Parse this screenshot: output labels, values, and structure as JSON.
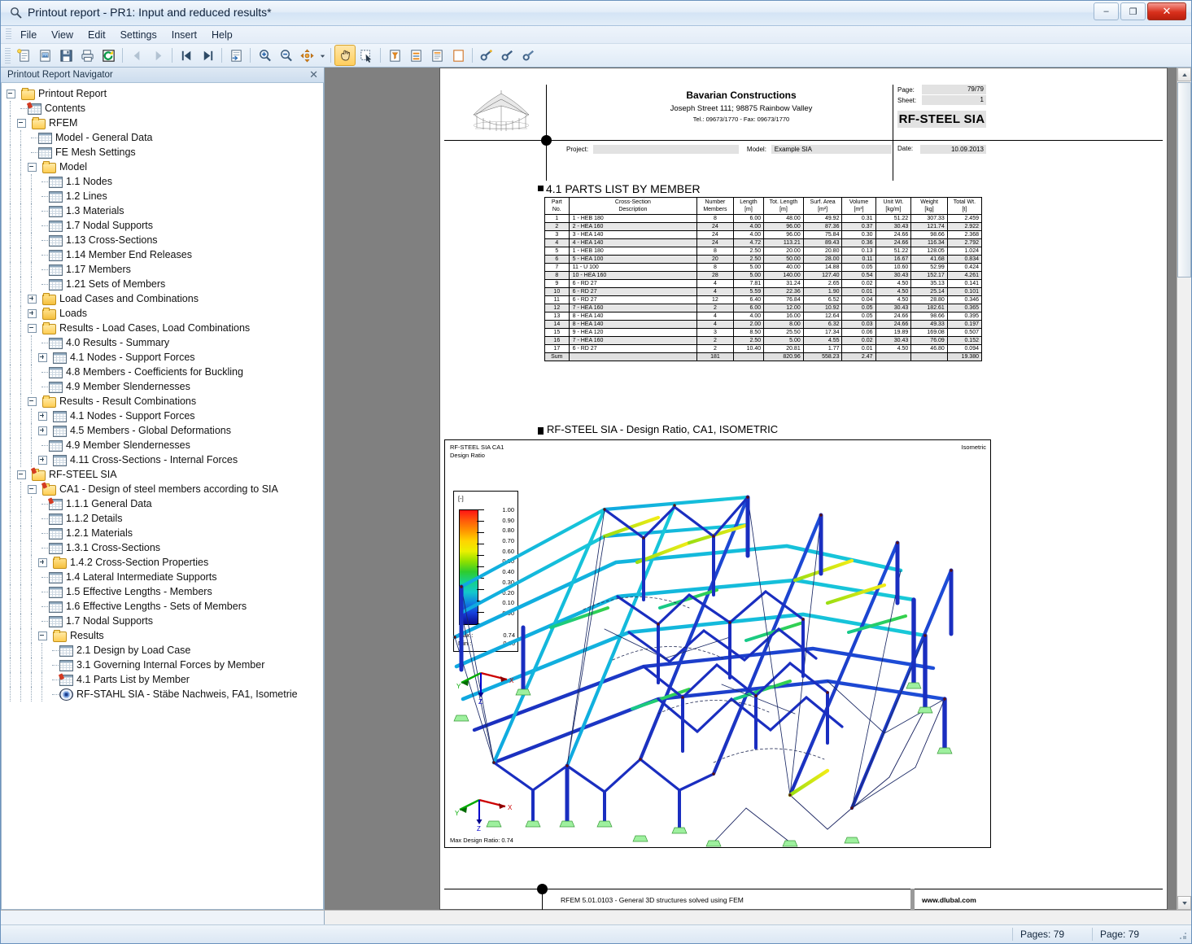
{
  "window": {
    "title": "Printout report - PR1: Input and reduced results*",
    "icon": "magnifier-document-icon",
    "minimize": "–",
    "maximize": "❐",
    "close": "✕"
  },
  "menubar": {
    "items": [
      {
        "label": "File",
        "name": "menu-file"
      },
      {
        "label": "View",
        "name": "menu-view"
      },
      {
        "label": "Edit",
        "name": "menu-edit"
      },
      {
        "label": "Settings",
        "name": "menu-settings"
      },
      {
        "label": "Insert",
        "name": "menu-insert"
      },
      {
        "label": "Help",
        "name": "menu-help"
      }
    ]
  },
  "toolbar": {
    "buttons": [
      {
        "name": "new-report-icon",
        "glyph": "📄",
        "state": "normal"
      },
      {
        "name": "open-report-icon",
        "glyph": "📂",
        "state": "normal"
      },
      {
        "name": "save-report-icon",
        "glyph": "💾",
        "state": "normal"
      },
      {
        "name": "print-icon",
        "glyph": "🖨",
        "state": "normal"
      },
      {
        "name": "refresh-icon",
        "glyph": "↻",
        "state": "normal"
      },
      {
        "name": "sep",
        "glyph": "",
        "state": "sep"
      },
      {
        "name": "previous-page-icon",
        "glyph": "◀",
        "state": "disabled"
      },
      {
        "name": "next-page-icon",
        "glyph": "▶",
        "state": "disabled"
      },
      {
        "name": "sep",
        "glyph": "",
        "state": "sep"
      },
      {
        "name": "first-page-icon",
        "glyph": "⏮",
        "state": "normal"
      },
      {
        "name": "last-page-icon",
        "glyph": "⏭",
        "state": "normal"
      },
      {
        "name": "sep",
        "glyph": "",
        "state": "sep"
      },
      {
        "name": "export-pdf-icon",
        "glyph": "📑",
        "state": "normal"
      },
      {
        "name": "sep",
        "glyph": "",
        "state": "sep"
      },
      {
        "name": "zoom-in-icon",
        "glyph": "🔍",
        "state": "normal"
      },
      {
        "name": "zoom-out-icon",
        "glyph": "🔎",
        "state": "normal"
      },
      {
        "name": "pan-move-icon",
        "glyph": "✥",
        "state": "normal"
      },
      {
        "name": "dropdown-arrow-icon",
        "glyph": "▾",
        "state": "small"
      },
      {
        "name": "sep",
        "glyph": "",
        "state": "sep"
      },
      {
        "name": "hand-tool-icon",
        "glyph": "✋",
        "state": "active"
      },
      {
        "name": "select-tool-icon",
        "glyph": "➤",
        "state": "normal"
      },
      {
        "name": "sep",
        "glyph": "",
        "state": "sep"
      },
      {
        "name": "filter-report-icon",
        "glyph": "▽",
        "state": "normal"
      },
      {
        "name": "report-settings-icon",
        "glyph": "☰",
        "state": "normal"
      },
      {
        "name": "page-setup-icon",
        "glyph": "≡",
        "state": "normal"
      },
      {
        "name": "blank-page-icon",
        "glyph": "▭",
        "state": "normal"
      },
      {
        "name": "sep",
        "glyph": "",
        "state": "sep"
      },
      {
        "name": "insert-link-icon",
        "glyph": "🔗",
        "state": "normal"
      },
      {
        "name": "edit-link-icon",
        "glyph": "🔗",
        "state": "normal"
      },
      {
        "name": "remove-link-icon",
        "glyph": "🔗",
        "state": "normal"
      }
    ]
  },
  "navigator": {
    "title": "Printout Report Navigator",
    "close_glyph": "✕",
    "tree": [
      {
        "label": "Printout Report",
        "depth": 0,
        "icon": "folder-open",
        "expander": "minus"
      },
      {
        "label": "Contents",
        "depth": 1,
        "icon": "sheet-pin",
        "expander": "none"
      },
      {
        "label": "RFEM",
        "depth": 1,
        "icon": "folder-open",
        "expander": "minus"
      },
      {
        "label": "Model - General Data",
        "depth": 2,
        "icon": "sheet",
        "expander": "none"
      },
      {
        "label": "FE Mesh Settings",
        "depth": 2,
        "icon": "sheet",
        "expander": "none"
      },
      {
        "label": "Model",
        "depth": 2,
        "icon": "folder-open",
        "expander": "minus"
      },
      {
        "label": "1.1 Nodes",
        "depth": 3,
        "icon": "sheet",
        "expander": "none"
      },
      {
        "label": "1.2 Lines",
        "depth": 3,
        "icon": "sheet",
        "expander": "none"
      },
      {
        "label": "1.3 Materials",
        "depth": 3,
        "icon": "sheet",
        "expander": "none"
      },
      {
        "label": "1.7 Nodal Supports",
        "depth": 3,
        "icon": "sheet",
        "expander": "none"
      },
      {
        "label": "1.13 Cross-Sections",
        "depth": 3,
        "icon": "sheet",
        "expander": "none"
      },
      {
        "label": "1.14 Member End Releases",
        "depth": 3,
        "icon": "sheet",
        "expander": "none"
      },
      {
        "label": "1.17 Members",
        "depth": 3,
        "icon": "sheet",
        "expander": "none"
      },
      {
        "label": "1.21 Sets of Members",
        "depth": 3,
        "icon": "sheet",
        "expander": "none"
      },
      {
        "label": "Load Cases and Combinations",
        "depth": 2,
        "icon": "folder",
        "expander": "plus"
      },
      {
        "label": "Loads",
        "depth": 2,
        "icon": "folder",
        "expander": "plus"
      },
      {
        "label": "Results - Load Cases, Load Combinations",
        "depth": 2,
        "icon": "folder-open",
        "expander": "minus"
      },
      {
        "label": "4.0 Results - Summary",
        "depth": 3,
        "icon": "sheet",
        "expander": "none"
      },
      {
        "label": "4.1 Nodes - Support Forces",
        "depth": 3,
        "icon": "sheet",
        "expander": "plus"
      },
      {
        "label": "4.8 Members - Coefficients for Buckling",
        "depth": 3,
        "icon": "sheet",
        "expander": "none"
      },
      {
        "label": "4.9 Member Slendernesses",
        "depth": 3,
        "icon": "sheet",
        "expander": "none"
      },
      {
        "label": "Results - Result Combinations",
        "depth": 2,
        "icon": "folder-open",
        "expander": "minus"
      },
      {
        "label": "4.1 Nodes - Support Forces",
        "depth": 3,
        "icon": "sheet",
        "expander": "plus"
      },
      {
        "label": "4.5 Members - Global Deformations",
        "depth": 3,
        "icon": "sheet",
        "expander": "plus"
      },
      {
        "label": "4.9 Member Slendernesses",
        "depth": 3,
        "icon": "sheet",
        "expander": "none"
      },
      {
        "label": "4.11 Cross-Sections - Internal Forces",
        "depth": 3,
        "icon": "sheet",
        "expander": "plus"
      },
      {
        "label": "RF-STEEL SIA",
        "depth": 1,
        "icon": "folder-pin",
        "expander": "minus"
      },
      {
        "label": "CA1 - Design of steel members according to SIA",
        "depth": 2,
        "icon": "folder-pin",
        "expander": "minus"
      },
      {
        "label": "1.1.1 General Data",
        "depth": 3,
        "icon": "sheet-pin",
        "expander": "none"
      },
      {
        "label": "1.1.2 Details",
        "depth": 3,
        "icon": "sheet",
        "expander": "none"
      },
      {
        "label": "1.2.1 Materials",
        "depth": 3,
        "icon": "sheet",
        "expander": "none"
      },
      {
        "label": "1.3.1 Cross-Sections",
        "depth": 3,
        "icon": "sheet",
        "expander": "none"
      },
      {
        "label": "1.4.2 Cross-Section Properties",
        "depth": 3,
        "icon": "folder",
        "expander": "plus"
      },
      {
        "label": "1.4 Lateral Intermediate Supports",
        "depth": 3,
        "icon": "sheet",
        "expander": "none"
      },
      {
        "label": "1.5 Effective Lengths - Members",
        "depth": 3,
        "icon": "sheet",
        "expander": "none"
      },
      {
        "label": "1.6 Effective Lengths - Sets of Members",
        "depth": 3,
        "icon": "sheet",
        "expander": "none"
      },
      {
        "label": "1.7 Nodal Supports",
        "depth": 3,
        "icon": "sheet",
        "expander": "none"
      },
      {
        "label": "Results",
        "depth": 3,
        "icon": "folder-open",
        "expander": "minus"
      },
      {
        "label": "2.1 Design by Load Case",
        "depth": 4,
        "icon": "sheet",
        "expander": "none"
      },
      {
        "label": "3.1 Governing Internal Forces by Member",
        "depth": 4,
        "icon": "sheet",
        "expander": "none"
      },
      {
        "label": "4.1 Parts List by Member",
        "depth": 4,
        "icon": "sheet-pin",
        "expander": "none"
      },
      {
        "label": "RF-STAHL SIA - Stäbe Nachweis, FA1, Isometrie",
        "depth": 4,
        "icon": "graphic",
        "expander": "none"
      }
    ]
  },
  "report": {
    "header": {
      "company_name": "Bavarian Constructions",
      "company_address": "Joseph Street 111; 98875 Rainbow Valley",
      "company_contact": "Tel.: 09673/1770 - Fax: 09673/1770",
      "page_key": "Page:",
      "page_value": "79/79",
      "sheet_key": "Sheet:",
      "sheet_value": "1",
      "module": "RF-STEEL SIA",
      "project_key": "Project:",
      "project_value": "",
      "model_key": "Model:",
      "model_value": "Example SIA",
      "date_key": "Date:",
      "date_value": "10.09.2013"
    },
    "section": {
      "title": "4.1 PARTS LIST BY MEMBER"
    },
    "parts_table": {
      "columns": [
        {
          "l1": "Part",
          "l2": "No."
        },
        {
          "l1": "Cross-Section",
          "l2": "Description"
        },
        {
          "l1": "Number",
          "l2": "Members"
        },
        {
          "l1": "Length",
          "l2": "[m]"
        },
        {
          "l1": "Tot. Length",
          "l2": "[m]"
        },
        {
          "l1": "Surf. Area",
          "l2": "[m²]"
        },
        {
          "l1": "Volume",
          "l2": "[m³]"
        },
        {
          "l1": "Unit Wt.",
          "l2": "[kg/m]"
        },
        {
          "l1": "Weight",
          "l2": "[kg]"
        },
        {
          "l1": "Total Wt.",
          "l2": "[t]"
        }
      ],
      "rows": [
        [
          "1",
          "1 - HEB 180",
          "8",
          "6.00",
          "48.00",
          "49.92",
          "0.31",
          "51.22",
          "307.33",
          "2.459"
        ],
        [
          "2",
          "2 - HEA 160",
          "24",
          "4.00",
          "96.00",
          "87.36",
          "0.37",
          "30.43",
          "121.74",
          "2.922"
        ],
        [
          "3",
          "3 - HEA 140",
          "24",
          "4.00",
          "96.00",
          "75.84",
          "0.30",
          "24.66",
          "98.66",
          "2.368"
        ],
        [
          "4",
          "4 - HEA 140",
          "24",
          "4.72",
          "113.21",
          "89.43",
          "0.36",
          "24.66",
          "116.34",
          "2.792"
        ],
        [
          "5",
          "1 - HEB 180",
          "8",
          "2.50",
          "20.00",
          "20.80",
          "0.13",
          "51.22",
          "128.05",
          "1.024"
        ],
        [
          "6",
          "5 - HEA 100",
          "20",
          "2.50",
          "50.00",
          "28.00",
          "0.11",
          "16.67",
          "41.68",
          "0.834"
        ],
        [
          "7",
          "11 - U 100",
          "8",
          "5.00",
          "40.00",
          "14.88",
          "0.05",
          "10.60",
          "52.99",
          "0.424"
        ],
        [
          "8",
          "10 - HEA 160",
          "28",
          "5.00",
          "140.00",
          "127.40",
          "0.54",
          "30.43",
          "152.17",
          "4.261"
        ],
        [
          "9",
          "6 - RD 27",
          "4",
          "7.81",
          "31.24",
          "2.65",
          "0.02",
          "4.50",
          "35.13",
          "0.141"
        ],
        [
          "10",
          "6 - RD 27",
          "4",
          "5.59",
          "22.36",
          "1.90",
          "0.01",
          "4.50",
          "25.14",
          "0.101"
        ],
        [
          "11",
          "6 - RD 27",
          "12",
          "6.40",
          "76.84",
          "6.52",
          "0.04",
          "4.50",
          "28.80",
          "0.346"
        ],
        [
          "12",
          "7 - HEA 160",
          "2",
          "6.00",
          "12.00",
          "10.92",
          "0.05",
          "30.43",
          "182.61",
          "0.365"
        ],
        [
          "13",
          "8 - HEA 140",
          "4",
          "4.00",
          "16.00",
          "12.64",
          "0.05",
          "24.66",
          "98.66",
          "0.395"
        ],
        [
          "14",
          "8 - HEA 140",
          "4",
          "2.00",
          "8.00",
          "6.32",
          "0.03",
          "24.66",
          "49.33",
          "0.197"
        ],
        [
          "15",
          "9 - HEA 120",
          "3",
          "8.50",
          "25.50",
          "17.34",
          "0.06",
          "19.89",
          "169.08",
          "0.507"
        ],
        [
          "16",
          "7 - HEA 160",
          "2",
          "2.50",
          "5.00",
          "4.55",
          "0.02",
          "30.43",
          "76.09",
          "0.152"
        ],
        [
          "17",
          "6 - RD 27",
          "2",
          "10.40",
          "20.81",
          "1.77",
          "0.01",
          "4.50",
          "46.80",
          "0.094"
        ]
      ],
      "sum_row": [
        "Sum",
        "",
        "181",
        "",
        "820.96",
        "558.23",
        "2.47",
        "",
        "",
        "19.380"
      ]
    },
    "graphic": {
      "title": "RF-STEEL SIA -  Design Ratio, CA1, ISOMETRIC",
      "label_top_left_1": "RF-STEEL SIA CA1",
      "label_top_left_2": "Design Ratio",
      "label_top_right": "Isometric",
      "label_bottom": "Max Design Ratio: 0.74",
      "legend": {
        "unit": "[-]",
        "ticks": [
          "1.00",
          "0.90",
          "0.80",
          "0.70",
          "0.60",
          "0.50",
          "0.40",
          "0.30",
          "0.20",
          "0.10",
          "0.00"
        ],
        "max_key": "Max :",
        "max_value": "0.74",
        "min_key": "Min :",
        "min_value": "0.00"
      },
      "axes": {
        "x": "X",
        "y": "Y",
        "z": "Z"
      }
    },
    "footer": {
      "text": "RFEM 5.01.0103 - General 3D structures solved using FEM",
      "website": "www.dlubal.com"
    }
  },
  "statusbar": {
    "pages_label": "Pages: 79",
    "page_label": "Page: 79"
  },
  "chart_data": {
    "type": "heatmap",
    "title": "RF-STEEL SIA - Design Ratio, CA1, ISOMETRIC",
    "ylabel": "Design Ratio [-]",
    "colorbar_ticks": [
      1.0,
      0.9,
      0.8,
      0.7,
      0.6,
      0.5,
      0.4,
      0.3,
      0.2,
      0.1,
      0.0
    ],
    "max": 0.74,
    "min": 0.0,
    "legend_position": "left",
    "annotation": "Max Design Ratio: 0.74"
  },
  "colors": {
    "accent": "#1f4e8c",
    "legend_high": "#ff1414",
    "legend_low": "#0a0a8c",
    "support": "#9ef09e",
    "axis_x": "#cc0000",
    "axis_y": "#00aa00",
    "axis_z": "#0000cc"
  }
}
